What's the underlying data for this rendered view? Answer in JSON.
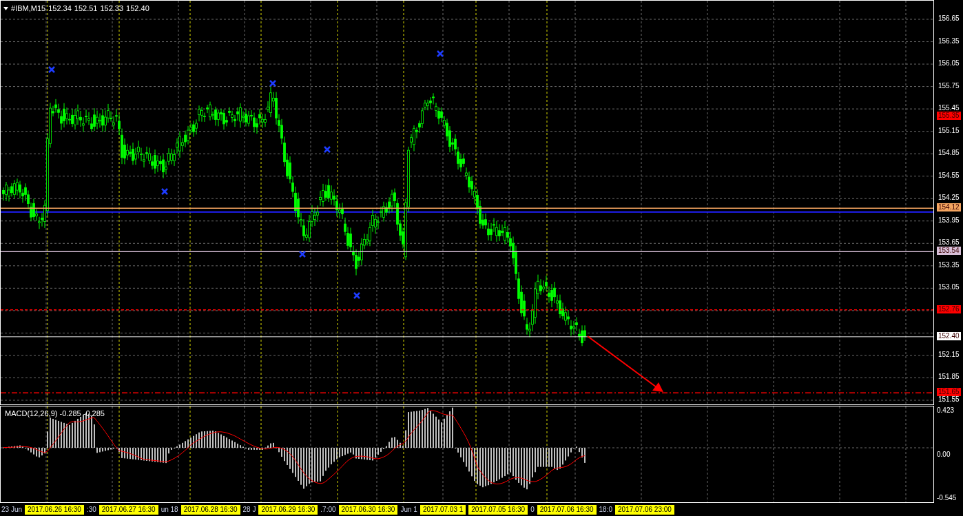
{
  "header": {
    "symbol": "#IBM,M15",
    "open": "152.34",
    "high": "152.51",
    "low": "152.33",
    "close": "152.40"
  },
  "price_axis": [
    "156.65",
    "156.35",
    "156.05",
    "155.75",
    "155.45",
    "155.15",
    "154.85",
    "154.55",
    "154.25",
    "153.95",
    "153.65",
    "153.35",
    "153.05",
    "152.15",
    "151.85",
    "151.55"
  ],
  "price_lines": [
    {
      "label": "155.35",
      "kind": "tag",
      "color": "#ff0000"
    },
    {
      "label": "154.12",
      "kind": "solid",
      "color": "#f4a460"
    },
    {
      "label": "153.54",
      "kind": "solid",
      "color": "#d8bfd8"
    },
    {
      "label": "152.76",
      "kind": "dashed",
      "color": "#ff0000"
    },
    {
      "label": "152.40",
      "kind": "current",
      "color": "#ffffff"
    },
    {
      "label": "151.65",
      "kind": "dashdot",
      "color": "#ff0000"
    }
  ],
  "macd": {
    "label": "MACD(12,26,9) -0.285 -0.285",
    "axis": [
      "0.423",
      "0.00",
      "-0.545"
    ]
  },
  "time_axis": [
    {
      "label": "23 Jun",
      "kind": "plain"
    },
    {
      "label": "2017.06.26 16:30",
      "kind": "highlight"
    },
    {
      "label": ":30",
      "kind": "plain"
    },
    {
      "label": "2017.06.27 16:30",
      "kind": "highlight"
    },
    {
      "label": "un 18",
      "kind": "plain"
    },
    {
      "label": "2017.06.28 16:30",
      "kind": "highlight"
    },
    {
      "label": "28 J",
      "kind": "plain"
    },
    {
      "label": "2017.06.29 16:30",
      "kind": "highlight"
    },
    {
      "label": ".7:00",
      "kind": "plain"
    },
    {
      "label": "2017.06.30 16:30",
      "kind": "highlight"
    },
    {
      "label": "Jun 1",
      "kind": "plain"
    },
    {
      "label": "2017.07.03 1",
      "kind": "highlight"
    },
    {
      "label": "2017.07.05 16:30",
      "kind": "highlight"
    },
    {
      "label": "0",
      "kind": "plain"
    },
    {
      "label": "2017.07.06 16:30",
      "kind": "highlight"
    },
    {
      "label": "18:0",
      "kind": "plain"
    },
    {
      "label": "2017.07.06 23:00",
      "kind": "highlight"
    }
  ]
}
